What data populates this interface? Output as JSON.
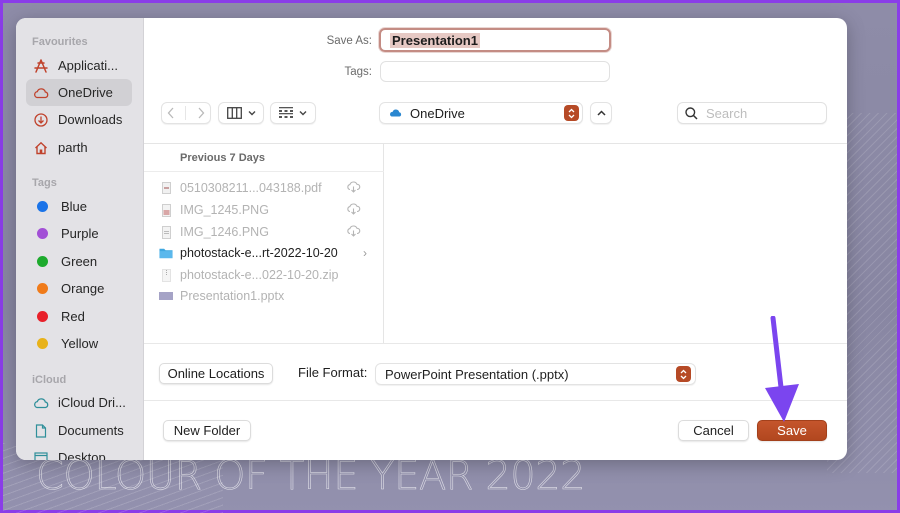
{
  "background": {
    "title": "COLOUR OF THE YEAR 2022",
    "frame_color": "#8a3de8"
  },
  "sidebar": {
    "sections": [
      {
        "title": "Favourites",
        "items": [
          {
            "label": "Applicati...",
            "icon": "applications-icon"
          },
          {
            "label": "OneDrive",
            "icon": "cloud-icon",
            "active": true
          },
          {
            "label": "Downloads",
            "icon": "download-icon"
          },
          {
            "label": "parth",
            "icon": "home-icon"
          }
        ]
      },
      {
        "title": "Tags",
        "items": [
          {
            "label": "Blue",
            "color": "#1a73e8"
          },
          {
            "label": "Purple",
            "color": "#a24fd6"
          },
          {
            "label": "Green",
            "color": "#1daa2d"
          },
          {
            "label": "Orange",
            "color": "#f07b1a"
          },
          {
            "label": "Red",
            "color": "#e8202a"
          },
          {
            "label": "Yellow",
            "color": "#e8b21a"
          }
        ]
      },
      {
        "title": "iCloud",
        "items": [
          {
            "label": "iCloud Dri...",
            "icon": "icloud-icon"
          },
          {
            "label": "Documents",
            "icon": "document-icon"
          },
          {
            "label": "Desktop",
            "icon": "desktop-icon"
          }
        ]
      }
    ]
  },
  "form": {
    "save_as_label": "Save As:",
    "save_as_value": "Presentation1",
    "tags_label": "Tags:",
    "tags_value": ""
  },
  "toolbar": {
    "location": "OneDrive",
    "search_placeholder": "Search"
  },
  "file_list": {
    "group_header": "Previous 7 Days",
    "items": [
      {
        "name": "0510308211...043188.pdf",
        "type": "pdf",
        "cloud": true
      },
      {
        "name": "IMG_1245.PNG",
        "type": "image",
        "cloud": true
      },
      {
        "name": "IMG_1246.PNG",
        "type": "image",
        "cloud": true
      },
      {
        "name": "photostack-e...rt-2022-10-20",
        "type": "folder",
        "cloud": false
      },
      {
        "name": "photostack-e...022-10-20.zip",
        "type": "zip",
        "cloud": false
      },
      {
        "name": "Presentation1.pptx",
        "type": "pptx",
        "cloud": false
      }
    ]
  },
  "options": {
    "online_locations_label": "Online Locations",
    "file_format_label": "File Format:",
    "file_format_value": "PowerPoint Presentation (.pptx)"
  },
  "footer": {
    "new_folder_label": "New Folder",
    "cancel_label": "Cancel",
    "save_label": "Save"
  },
  "colors": {
    "accent": "#b64a26",
    "annotation_arrow": "#7b45ef"
  }
}
